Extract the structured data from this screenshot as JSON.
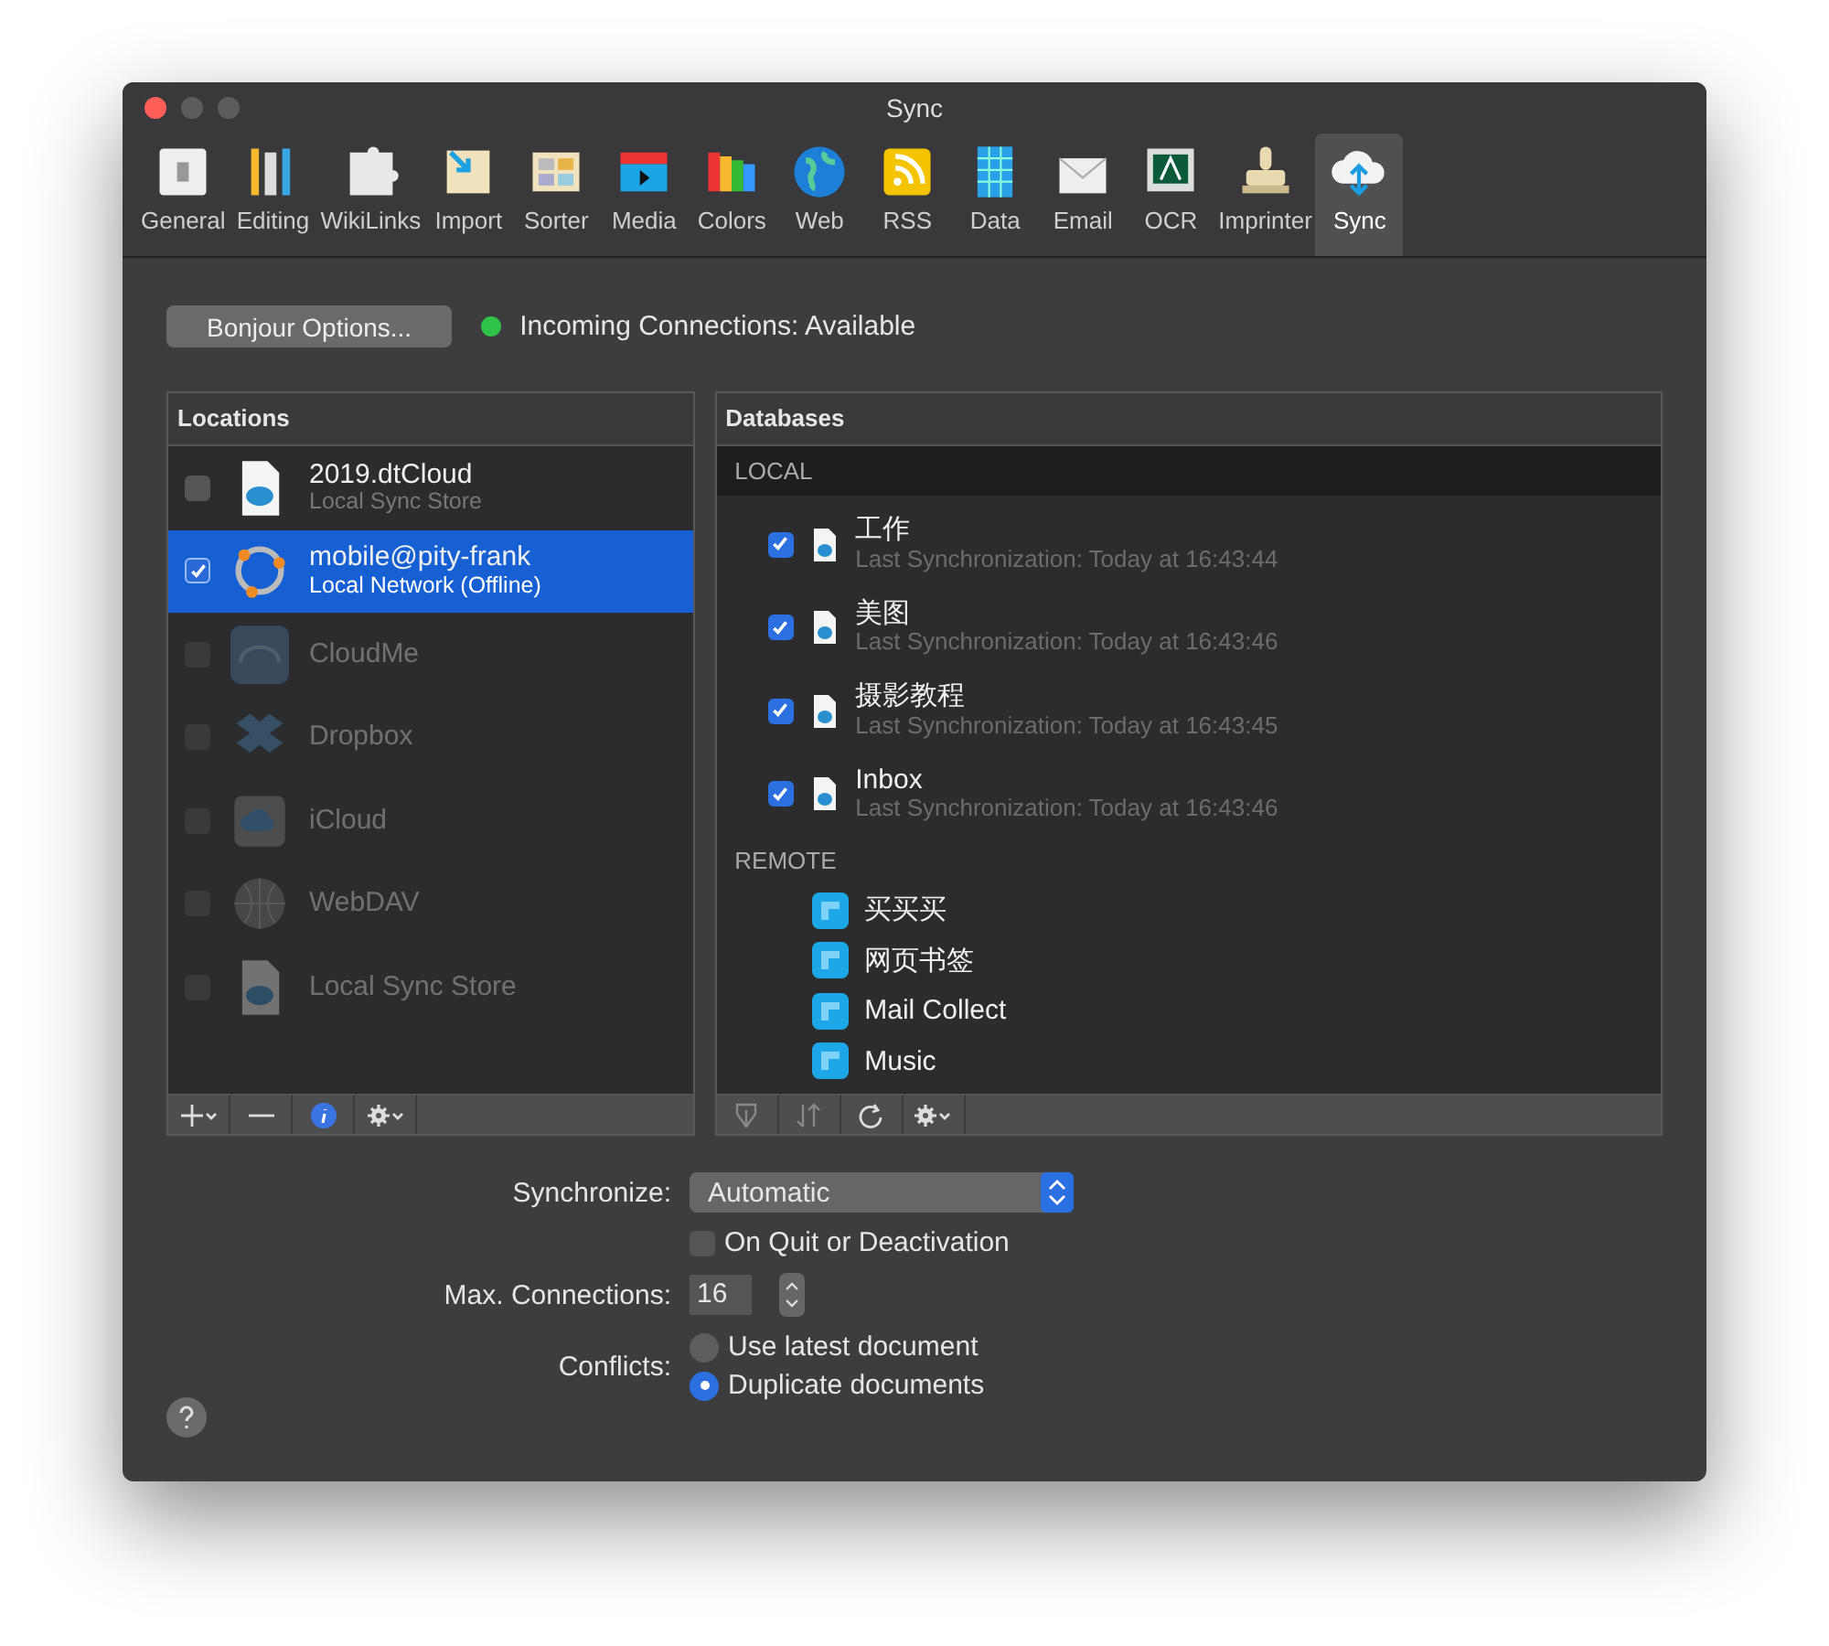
{
  "window": {
    "title": "Sync"
  },
  "tabs": [
    {
      "label": "General",
      "selected": false
    },
    {
      "label": "Editing",
      "selected": false
    },
    {
      "label": "WikiLinks",
      "selected": false
    },
    {
      "label": "Import",
      "selected": false
    },
    {
      "label": "Sorter",
      "selected": false
    },
    {
      "label": "Media",
      "selected": false
    },
    {
      "label": "Colors",
      "selected": false
    },
    {
      "label": "Web",
      "selected": false
    },
    {
      "label": "RSS",
      "selected": false
    },
    {
      "label": "Data",
      "selected": false
    },
    {
      "label": "Email",
      "selected": false
    },
    {
      "label": "OCR",
      "selected": false
    },
    {
      "label": "Imprinter",
      "selected": false
    },
    {
      "label": "Sync",
      "selected": true
    }
  ],
  "bonjour_button": "Bonjour Options...",
  "connection_status": {
    "text": "Incoming Connections: Available",
    "available": true
  },
  "locations": {
    "title": "Locations",
    "items": [
      {
        "kind": "file",
        "name": "2019.dtCloud",
        "detail": "Local Sync Store",
        "checked": false,
        "selected": false,
        "disabled": false
      },
      {
        "kind": "network",
        "name": "mobile@pity-frank",
        "detail": "Local Network (Offline)",
        "checked": true,
        "selected": true,
        "disabled": false
      },
      {
        "kind": "cloudme",
        "name": "CloudMe",
        "checked": false,
        "selected": false,
        "disabled": true
      },
      {
        "kind": "dropbox",
        "name": "Dropbox",
        "checked": false,
        "selected": false,
        "disabled": true
      },
      {
        "kind": "icloud",
        "name": "iCloud",
        "checked": false,
        "selected": false,
        "disabled": true
      },
      {
        "kind": "webdav",
        "name": "WebDAV",
        "checked": false,
        "selected": false,
        "disabled": true
      },
      {
        "kind": "file",
        "name": "Local Sync Store",
        "checked": false,
        "selected": false,
        "disabled": true
      }
    ]
  },
  "databases": {
    "title": "Databases",
    "local_header": "LOCAL",
    "local": [
      {
        "name": "工作",
        "detail": "Last Synchronization: Today at 16:43:44",
        "checked": true
      },
      {
        "name": "美图",
        "detail": "Last Synchronization: Today at 16:43:46",
        "checked": true
      },
      {
        "name": "摄影教程",
        "detail": "Last Synchronization: Today at 16:43:45",
        "checked": true
      },
      {
        "name": "Inbox",
        "detail": "Last Synchronization: Today at 16:43:46",
        "checked": true
      }
    ],
    "remote_header": "REMOTE",
    "remote": [
      {
        "name": "买买买"
      },
      {
        "name": "网页书签"
      },
      {
        "name": "Mail Collect"
      },
      {
        "name": "Music"
      }
    ]
  },
  "settings": {
    "synchronize_label": "Synchronize:",
    "synchronize_value": "Automatic",
    "on_quit": {
      "label": "On Quit or Deactivation",
      "checked": false
    },
    "max_connections_label": "Max. Connections:",
    "max_connections_value": "16",
    "conflicts_label": "Conflicts:",
    "conflicts": [
      {
        "label": "Use latest document",
        "selected": false
      },
      {
        "label": "Duplicate documents",
        "selected": true
      }
    ]
  }
}
